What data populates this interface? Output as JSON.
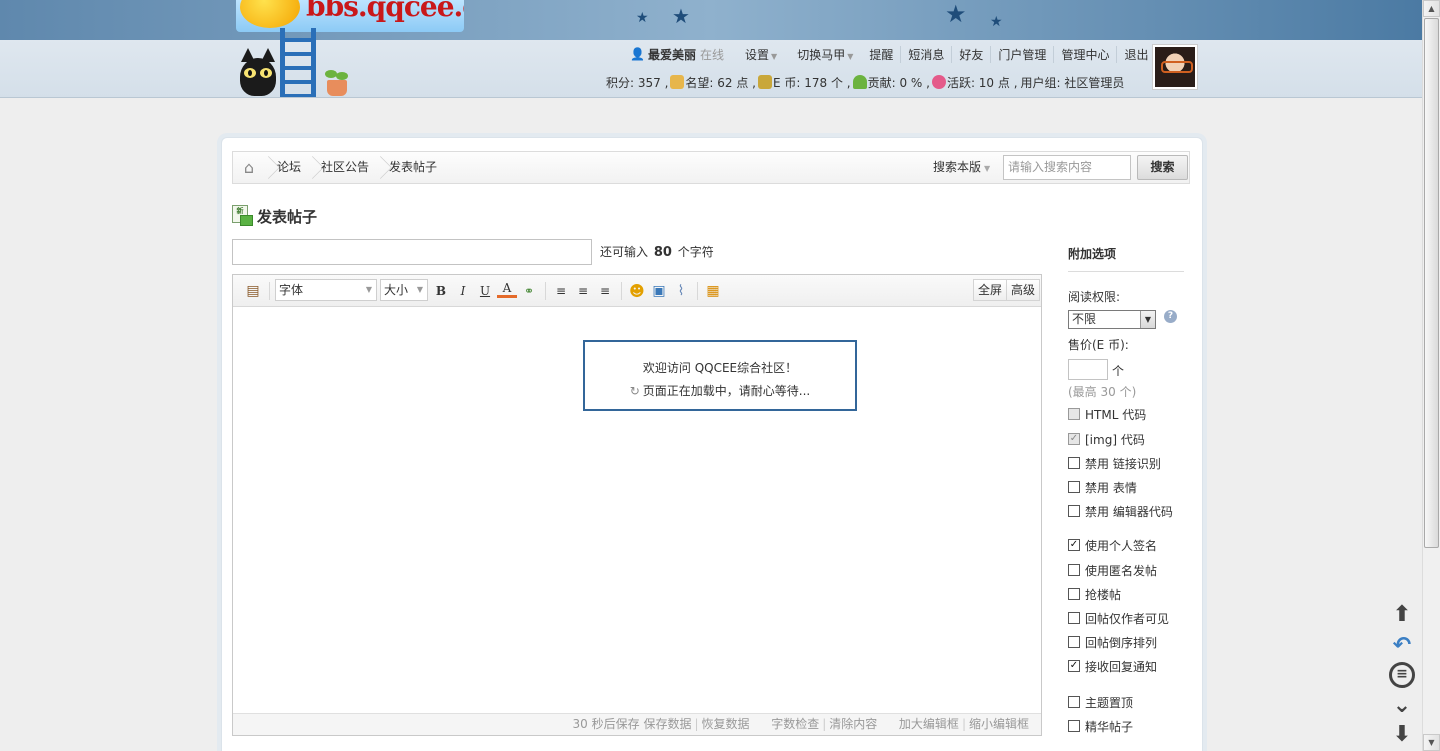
{
  "header": {
    "logo_text": "bbs.qqcee.com",
    "user": {
      "name": "最爱美丽",
      "status": "在线"
    },
    "nav": [
      {
        "label": "设置",
        "dropdown": true
      },
      {
        "label": "切换马甲",
        "dropdown": true
      },
      {
        "label": "提醒",
        "dropdown": false
      },
      {
        "label": "短消息",
        "dropdown": false
      },
      {
        "label": "好友",
        "dropdown": false
      },
      {
        "label": "门户管理",
        "dropdown": false
      },
      {
        "label": "管理中心",
        "dropdown": false
      },
      {
        "label": "退出",
        "dropdown": false
      }
    ],
    "stats": {
      "points": "积分: 357 ,",
      "reputation": "名望: 62 点 ,",
      "ecoin": "E 币: 178 个 ,",
      "contribution": "贡献: 0 % ,",
      "activity": "活跃: 10 点 ,",
      "usergroup": "用户组: 社区管理员"
    }
  },
  "breadcrumb": {
    "items": [
      "论坛",
      "社区公告",
      "发表帖子"
    ]
  },
  "search": {
    "scope": "搜索本版",
    "placeholder": "请输入搜索内容",
    "button": "搜索"
  },
  "page": {
    "title": "发表帖子",
    "new_icon_text": "新",
    "subject_hint_before": "还可输入",
    "subject_hint_count": "80",
    "subject_hint_after": "个字符"
  },
  "editor": {
    "font_select": "字体",
    "size_select": "大小",
    "fullscreen": "全屏",
    "advanced": "高级",
    "loading_line1": "欢迎访问 QQCEE综合社区！",
    "loading_line2": "页面正在加载中，请耐心等待...",
    "footer": {
      "autosave": "30 秒后保存",
      "save": "保存数据",
      "restore": "恢复数据",
      "wordcheck": "字数检查",
      "clear": "清除内容",
      "enlarge": "加大编辑框",
      "shrink": "缩小编辑框"
    }
  },
  "options": {
    "title": "附加选项",
    "read_perm_label": "阅读权限:",
    "read_perm_value": "不限",
    "price_label": "售价(E 币):",
    "price_unit": "个",
    "price_max": "(最高 30 个)",
    "checkboxes": [
      {
        "label": "HTML 代码",
        "checked": false,
        "disabled": true
      },
      {
        "label": "[img] 代码",
        "checked": true,
        "disabled": true
      },
      {
        "label": "禁用 链接识别",
        "checked": false,
        "disabled": false
      },
      {
        "label": "禁用 表情",
        "checked": false,
        "disabled": false
      },
      {
        "label": "禁用 编辑器代码",
        "checked": false,
        "disabled": false
      },
      {
        "label": "使用个人签名",
        "checked": true,
        "disabled": false
      },
      {
        "label": "使用匿名发帖",
        "checked": false,
        "disabled": false
      },
      {
        "label": "抢楼帖",
        "checked": false,
        "disabled": false
      },
      {
        "label": "回帖仅作者可见",
        "checked": false,
        "disabled": false
      },
      {
        "label": "回帖倒序排列",
        "checked": false,
        "disabled": false
      },
      {
        "label": "接收回复通知",
        "checked": true,
        "disabled": false
      },
      {
        "label": "主题置顶",
        "checked": false,
        "disabled": false
      },
      {
        "label": "精华帖子",
        "checked": false,
        "disabled": false
      }
    ]
  },
  "icons": {
    "home": "home-icon",
    "user": "user-icon",
    "paste": "paste-icon",
    "bold": "B",
    "italic": "I",
    "underline": "U",
    "font_color": "A",
    "emoticon": "emoticon-icon",
    "image": "image-icon",
    "attachment": "attachment-icon",
    "media": "media-icon",
    "float_up": "arrow-up-icon",
    "float_back": "reply-icon",
    "float_list": "list-icon",
    "float_down": "chevron-down-icon",
    "float_bottom": "arrow-down-icon"
  },
  "colors": {
    "header_blue": "#3d6b92",
    "loading_border": "#336699",
    "logo_red": "#c9181a"
  }
}
